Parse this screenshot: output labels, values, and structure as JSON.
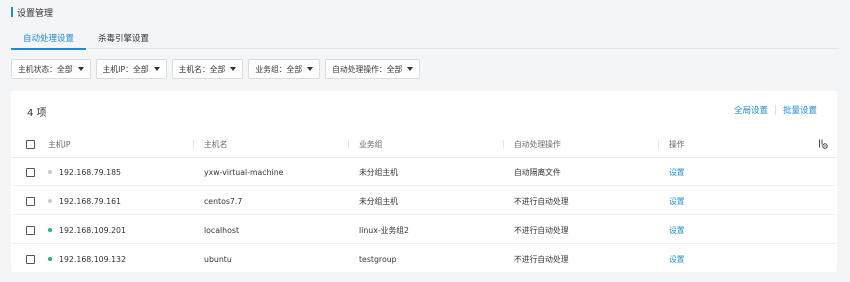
{
  "page": {
    "title": "设置管理"
  },
  "tabs": [
    {
      "label": "自动处理设置",
      "active": true
    },
    {
      "label": "杀毒引擎设置",
      "active": false
    }
  ],
  "filters": [
    {
      "label": "主机状态：全部"
    },
    {
      "label": "主机IP：全部"
    },
    {
      "label": "主机名：全部"
    },
    {
      "label": "业务组：全部"
    },
    {
      "label": "自动处理操作：全部"
    }
  ],
  "table": {
    "count_label": "4 项",
    "actions": {
      "global_settings": "全局设置",
      "batch_settings": "批量设置"
    },
    "headers": {
      "ip": "主机IP",
      "hostname": "主机名",
      "group": "业务组",
      "auto_action": "自动处理操作",
      "operation": "操作"
    },
    "rows": [
      {
        "status_color": "#c8cacc",
        "ip": "192.168.79.185",
        "hostname": "yxw-virtual-machine",
        "group": "未分组主机",
        "auto_action": "自动隔离文件",
        "operation": "设置"
      },
      {
        "status_color": "#c8cacc",
        "ip": "192.168.79.161",
        "hostname": "centos7.7",
        "group": "未分组主机",
        "auto_action": "不进行自动处理",
        "operation": "设置"
      },
      {
        "status_color": "#22b573",
        "ip": "192.168.109.201",
        "hostname": "localhost",
        "group": "linux-业务组2",
        "auto_action": "不进行自动处理",
        "operation": "设置"
      },
      {
        "status_color": "#22b573",
        "ip": "192.168.109.132",
        "hostname": "ubuntu",
        "group": "testgroup",
        "auto_action": "不进行自动处理",
        "operation": "设置"
      }
    ]
  },
  "colors": {
    "accent": "#1f8ad6",
    "online": "#22b573",
    "offline": "#c8cacc"
  },
  "icons": {
    "column_settings": "column-settings-icon",
    "dropdown": "caret-down-icon"
  }
}
